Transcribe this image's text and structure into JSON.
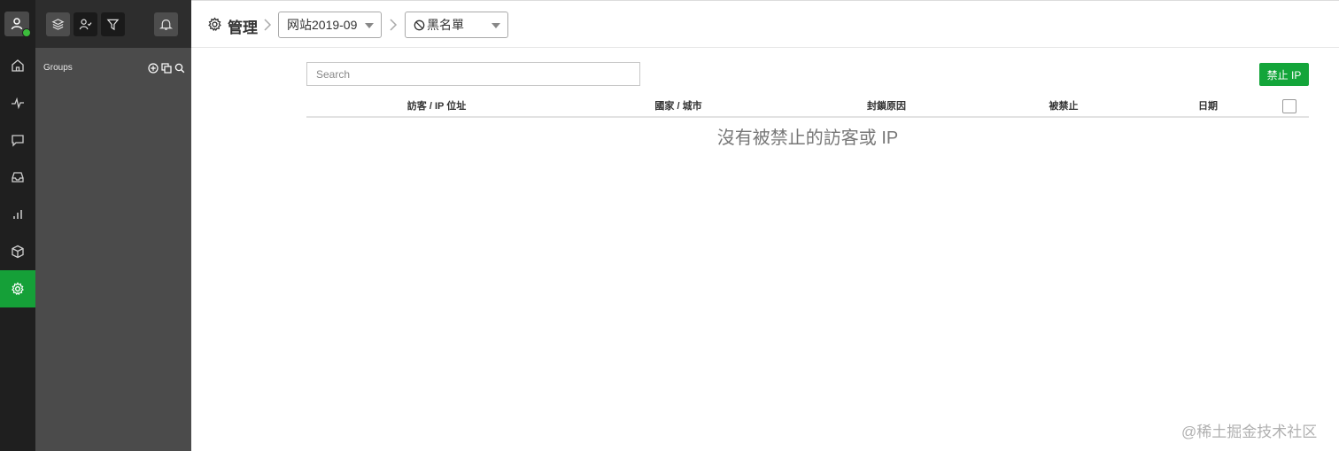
{
  "rail": {
    "items": [
      {
        "icon": "home-icon"
      },
      {
        "icon": "activity-icon"
      },
      {
        "icon": "chat-icon"
      },
      {
        "icon": "inbox-icon"
      },
      {
        "icon": "bar-chart-icon"
      },
      {
        "icon": "package-icon"
      },
      {
        "icon": "settings-icon",
        "active": true
      }
    ],
    "active_color": "#15a038"
  },
  "panel": {
    "groups_label": "Groups"
  },
  "header": {
    "title": "管理",
    "site_select": "网站2019-09",
    "section_select": "黑名單"
  },
  "main": {
    "search_placeholder": "Search",
    "ban_button": "禁止 IP",
    "ban_button_color": "#13a53a",
    "columns": [
      "訪客 / IP 位址",
      "國家 / 城市",
      "封鎖原因",
      "被禁止",
      "日期"
    ],
    "empty_message": "沒有被禁止的訪客或 IP"
  },
  "watermark": "@稀土掘金技术社区"
}
